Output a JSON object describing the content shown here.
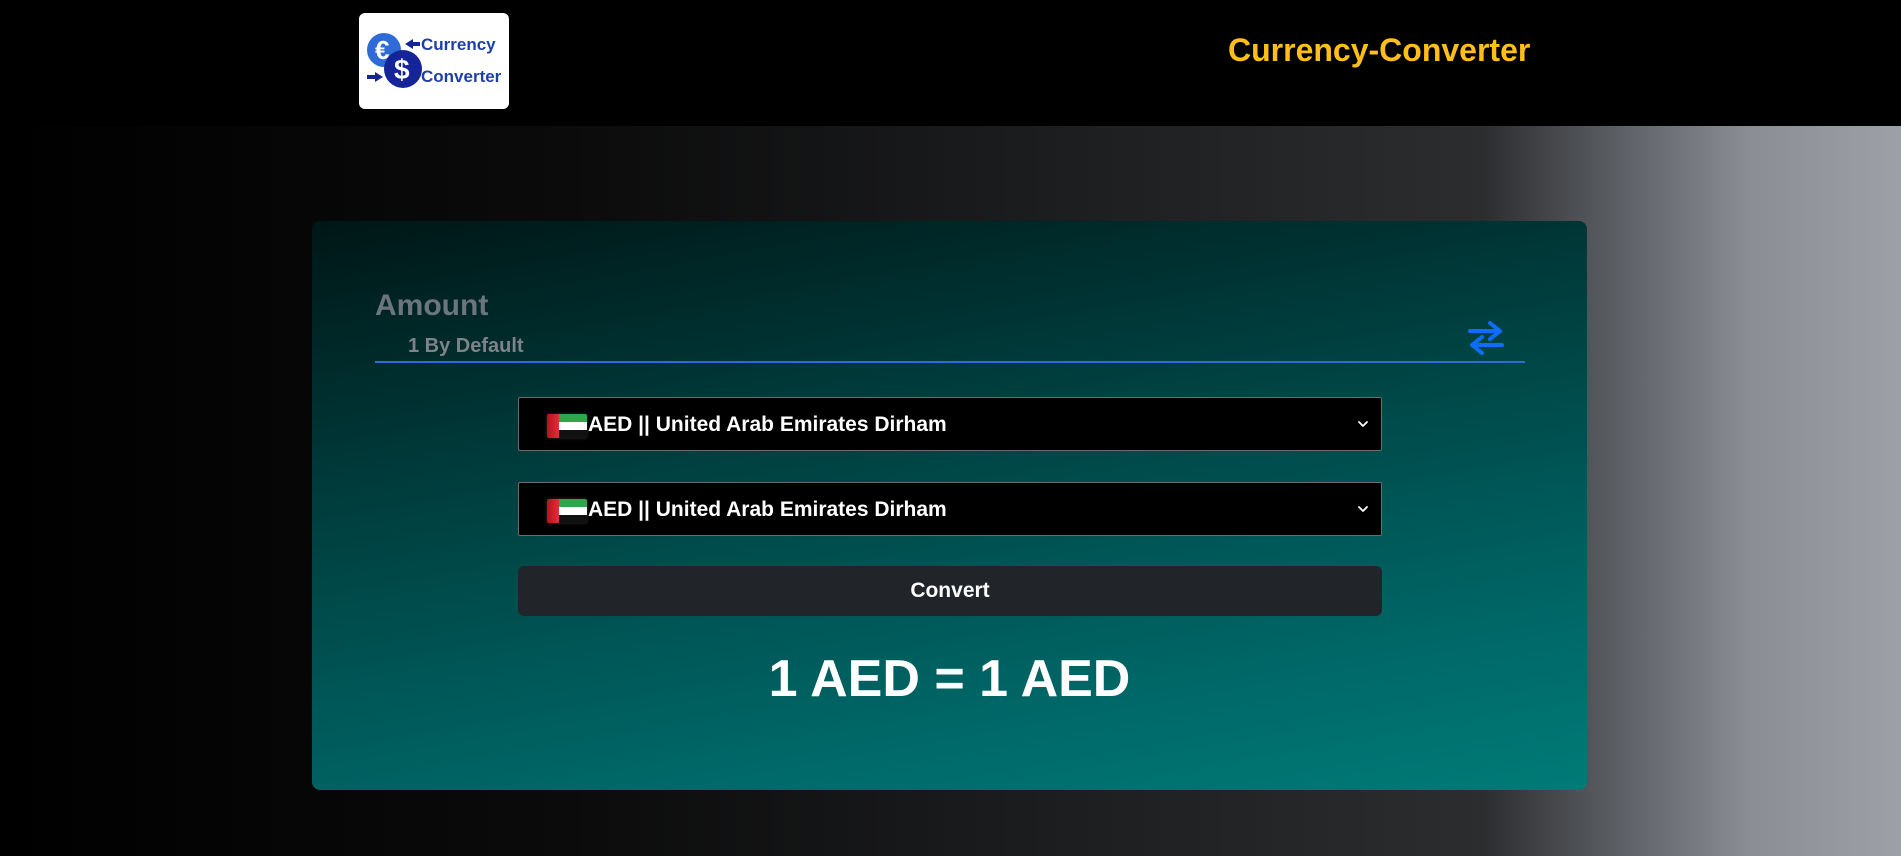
{
  "header": {
    "logo": {
      "line1": "Currency",
      "line2": "Converter"
    },
    "title": "Currency-Converter",
    "title_color": "#ffbf17"
  },
  "converter": {
    "amount_label": "Amount",
    "amount_placeholder": "1 By Default",
    "amount_value": "",
    "swap_icon": "swap-arrows-icon",
    "from_select": {
      "flag": "AE",
      "selected": "AED || United Arab Emirates Dirham"
    },
    "to_select": {
      "flag": "AE",
      "selected": "AED || United Arab Emirates Dirham"
    },
    "convert_label": "Convert",
    "result": "1 AED = 1 AED"
  },
  "colors": {
    "accent_blue": "#2f6bd6",
    "header_bg": "#000000",
    "button_bg": "#212529"
  }
}
